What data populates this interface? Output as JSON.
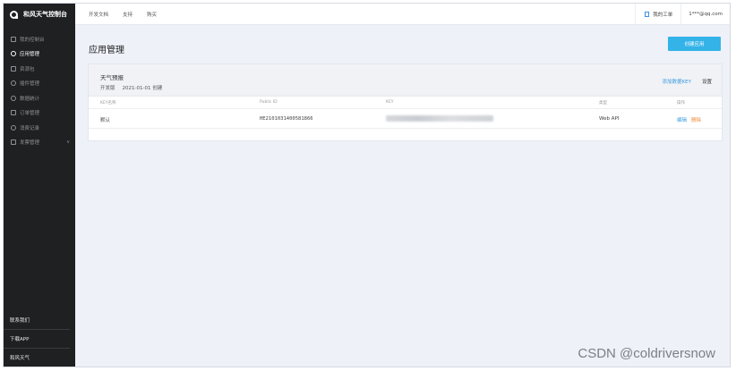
{
  "sidebar": {
    "brand": "和风天气控制台",
    "items": [
      {
        "label": "我的控制台",
        "icon": "monitor-icon"
      },
      {
        "label": "应用管理",
        "icon": "gear-icon",
        "active": true
      },
      {
        "label": "资源包",
        "icon": "package-icon"
      },
      {
        "label": "插件管理",
        "icon": "plugin-icon"
      },
      {
        "label": "数据统计",
        "icon": "stats-icon"
      },
      {
        "label": "订单管理",
        "icon": "order-icon"
      },
      {
        "label": "消费记录",
        "icon": "record-icon"
      },
      {
        "label": "发票管理",
        "icon": "invoice-icon"
      }
    ],
    "bottom": [
      "联系我们",
      "下载APP",
      "和风天气"
    ]
  },
  "topbar": {
    "nav": [
      "开发文档",
      "支持",
      "购买"
    ],
    "ticket": "我的工单",
    "account": "1***@qq.com"
  },
  "main": {
    "title": "应用管理",
    "create_button": "创建应用",
    "app": {
      "name": "天气预报",
      "plan": "开发版",
      "created": "2021-01-01 创建",
      "add_key": "添加数据KEY",
      "settings": "设置"
    },
    "table": {
      "headers": [
        "KEY名称",
        "Public ID",
        "KEY",
        "类型",
        "操作"
      ],
      "rows": [
        {
          "name": "默认",
          "public_id": "HE2101031400581866",
          "type": "Web API",
          "edit": "编辑",
          "delete": "删除"
        }
      ]
    }
  },
  "watermark": "CSDN @coldriversnow"
}
